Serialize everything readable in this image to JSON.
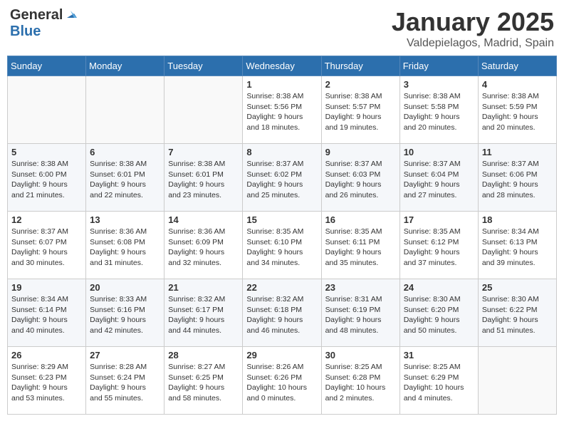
{
  "header": {
    "logo_line1": "General",
    "logo_line2": "Blue",
    "month_title": "January 2025",
    "location": "Valdepielagos, Madrid, Spain"
  },
  "days_of_week": [
    "Sunday",
    "Monday",
    "Tuesday",
    "Wednesday",
    "Thursday",
    "Friday",
    "Saturday"
  ],
  "weeks": [
    [
      {
        "day": "",
        "info": ""
      },
      {
        "day": "",
        "info": ""
      },
      {
        "day": "",
        "info": ""
      },
      {
        "day": "1",
        "info": "Sunrise: 8:38 AM\nSunset: 5:56 PM\nDaylight: 9 hours\nand 18 minutes."
      },
      {
        "day": "2",
        "info": "Sunrise: 8:38 AM\nSunset: 5:57 PM\nDaylight: 9 hours\nand 19 minutes."
      },
      {
        "day": "3",
        "info": "Sunrise: 8:38 AM\nSunset: 5:58 PM\nDaylight: 9 hours\nand 20 minutes."
      },
      {
        "day": "4",
        "info": "Sunrise: 8:38 AM\nSunset: 5:59 PM\nDaylight: 9 hours\nand 20 minutes."
      }
    ],
    [
      {
        "day": "5",
        "info": "Sunrise: 8:38 AM\nSunset: 6:00 PM\nDaylight: 9 hours\nand 21 minutes."
      },
      {
        "day": "6",
        "info": "Sunrise: 8:38 AM\nSunset: 6:01 PM\nDaylight: 9 hours\nand 22 minutes."
      },
      {
        "day": "7",
        "info": "Sunrise: 8:38 AM\nSunset: 6:01 PM\nDaylight: 9 hours\nand 23 minutes."
      },
      {
        "day": "8",
        "info": "Sunrise: 8:37 AM\nSunset: 6:02 PM\nDaylight: 9 hours\nand 25 minutes."
      },
      {
        "day": "9",
        "info": "Sunrise: 8:37 AM\nSunset: 6:03 PM\nDaylight: 9 hours\nand 26 minutes."
      },
      {
        "day": "10",
        "info": "Sunrise: 8:37 AM\nSunset: 6:04 PM\nDaylight: 9 hours\nand 27 minutes."
      },
      {
        "day": "11",
        "info": "Sunrise: 8:37 AM\nSunset: 6:06 PM\nDaylight: 9 hours\nand 28 minutes."
      }
    ],
    [
      {
        "day": "12",
        "info": "Sunrise: 8:37 AM\nSunset: 6:07 PM\nDaylight: 9 hours\nand 30 minutes."
      },
      {
        "day": "13",
        "info": "Sunrise: 8:36 AM\nSunset: 6:08 PM\nDaylight: 9 hours\nand 31 minutes."
      },
      {
        "day": "14",
        "info": "Sunrise: 8:36 AM\nSunset: 6:09 PM\nDaylight: 9 hours\nand 32 minutes."
      },
      {
        "day": "15",
        "info": "Sunrise: 8:35 AM\nSunset: 6:10 PM\nDaylight: 9 hours\nand 34 minutes."
      },
      {
        "day": "16",
        "info": "Sunrise: 8:35 AM\nSunset: 6:11 PM\nDaylight: 9 hours\nand 35 minutes."
      },
      {
        "day": "17",
        "info": "Sunrise: 8:35 AM\nSunset: 6:12 PM\nDaylight: 9 hours\nand 37 minutes."
      },
      {
        "day": "18",
        "info": "Sunrise: 8:34 AM\nSunset: 6:13 PM\nDaylight: 9 hours\nand 39 minutes."
      }
    ],
    [
      {
        "day": "19",
        "info": "Sunrise: 8:34 AM\nSunset: 6:14 PM\nDaylight: 9 hours\nand 40 minutes."
      },
      {
        "day": "20",
        "info": "Sunrise: 8:33 AM\nSunset: 6:16 PM\nDaylight: 9 hours\nand 42 minutes."
      },
      {
        "day": "21",
        "info": "Sunrise: 8:32 AM\nSunset: 6:17 PM\nDaylight: 9 hours\nand 44 minutes."
      },
      {
        "day": "22",
        "info": "Sunrise: 8:32 AM\nSunset: 6:18 PM\nDaylight: 9 hours\nand 46 minutes."
      },
      {
        "day": "23",
        "info": "Sunrise: 8:31 AM\nSunset: 6:19 PM\nDaylight: 9 hours\nand 48 minutes."
      },
      {
        "day": "24",
        "info": "Sunrise: 8:30 AM\nSunset: 6:20 PM\nDaylight: 9 hours\nand 50 minutes."
      },
      {
        "day": "25",
        "info": "Sunrise: 8:30 AM\nSunset: 6:22 PM\nDaylight: 9 hours\nand 51 minutes."
      }
    ],
    [
      {
        "day": "26",
        "info": "Sunrise: 8:29 AM\nSunset: 6:23 PM\nDaylight: 9 hours\nand 53 minutes."
      },
      {
        "day": "27",
        "info": "Sunrise: 8:28 AM\nSunset: 6:24 PM\nDaylight: 9 hours\nand 55 minutes."
      },
      {
        "day": "28",
        "info": "Sunrise: 8:27 AM\nSunset: 6:25 PM\nDaylight: 9 hours\nand 58 minutes."
      },
      {
        "day": "29",
        "info": "Sunrise: 8:26 AM\nSunset: 6:26 PM\nDaylight: 10 hours\nand 0 minutes."
      },
      {
        "day": "30",
        "info": "Sunrise: 8:25 AM\nSunset: 6:28 PM\nDaylight: 10 hours\nand 2 minutes."
      },
      {
        "day": "31",
        "info": "Sunrise: 8:25 AM\nSunset: 6:29 PM\nDaylight: 10 hours\nand 4 minutes."
      },
      {
        "day": "",
        "info": ""
      }
    ]
  ]
}
